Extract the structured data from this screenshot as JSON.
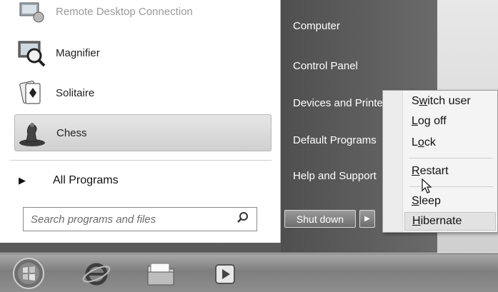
{
  "programs": [
    {
      "label": "Remote Desktop Connection",
      "icon": "remote-desktop-icon"
    },
    {
      "label": "Magnifier",
      "icon": "magnifier-icon"
    },
    {
      "label": "Solitaire",
      "icon": "solitaire-icon"
    },
    {
      "label": "Chess",
      "icon": "chess-icon"
    }
  ],
  "all_programs": {
    "label": "All Programs",
    "icon": "right-triangle-icon"
  },
  "search": {
    "placeholder": "Search programs and files",
    "icon": "search-icon"
  },
  "right_pane": {
    "items": [
      {
        "label": "Computer"
      },
      {
        "label": "Control Panel"
      },
      {
        "label": "Devices and Printers"
      },
      {
        "label": "Default Programs"
      },
      {
        "label": "Help and Support"
      }
    ],
    "shutdown_label": "Shut down"
  },
  "power_menu": {
    "items": [
      {
        "pre": "S",
        "ul": "w",
        "post": "itch user"
      },
      {
        "pre": "",
        "ul": "L",
        "post": "og off"
      },
      {
        "pre": "L",
        "ul": "o",
        "post": "ck"
      },
      {
        "pre": "",
        "ul": "R",
        "post": "estart"
      },
      {
        "pre": "",
        "ul": "S",
        "post": "leep"
      },
      {
        "pre": "",
        "ul": "H",
        "post": "ibernate"
      }
    ]
  },
  "taskbar": {
    "items": [
      "start-orb-icon",
      "internet-explorer-icon",
      "file-explorer-icon",
      "media-player-icon"
    ]
  },
  "colors": {
    "right_pane": "#5c5c5c",
    "menu_bg": "#ffffff",
    "taskbar": "#8e8e8e"
  }
}
